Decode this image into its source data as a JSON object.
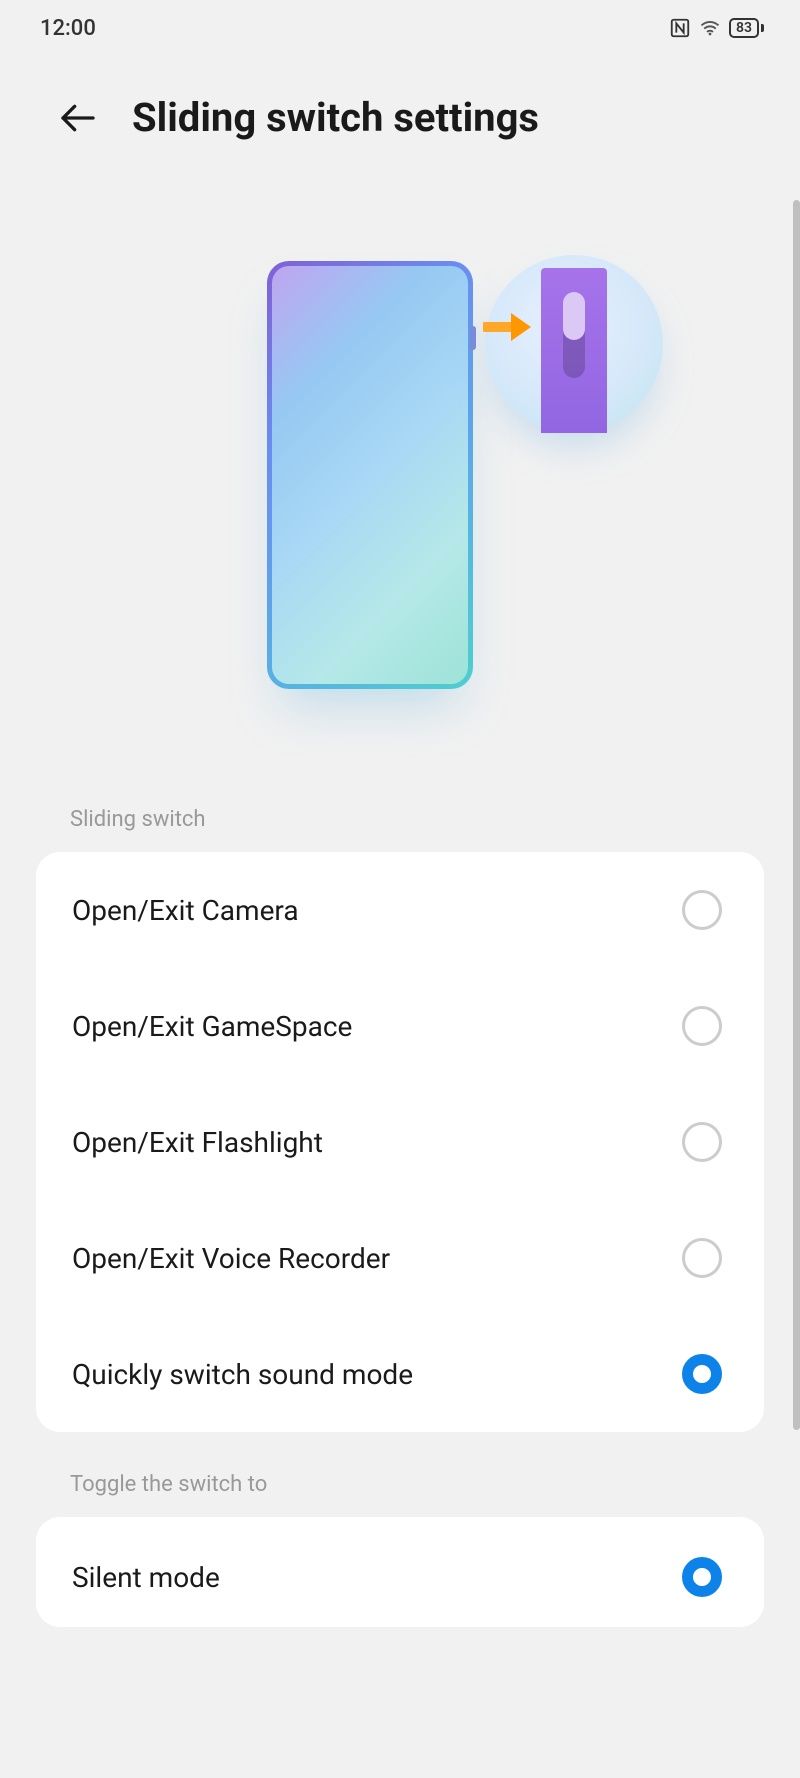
{
  "statusBar": {
    "time": "12:00",
    "battery": "83"
  },
  "header": {
    "title": "Sliding switch settings"
  },
  "sections": {
    "slidingSwitch": {
      "label": "Sliding switch",
      "options": [
        {
          "label": "Open/Exit Camera",
          "selected": false
        },
        {
          "label": "Open/Exit GameSpace",
          "selected": false
        },
        {
          "label": "Open/Exit Flashlight",
          "selected": false
        },
        {
          "label": "Open/Exit Voice Recorder",
          "selected": false
        },
        {
          "label": "Quickly switch sound mode",
          "selected": true
        }
      ]
    },
    "toggle": {
      "label": "Toggle the switch to",
      "options": [
        {
          "label": "Silent mode",
          "selected": true
        }
      ]
    }
  }
}
